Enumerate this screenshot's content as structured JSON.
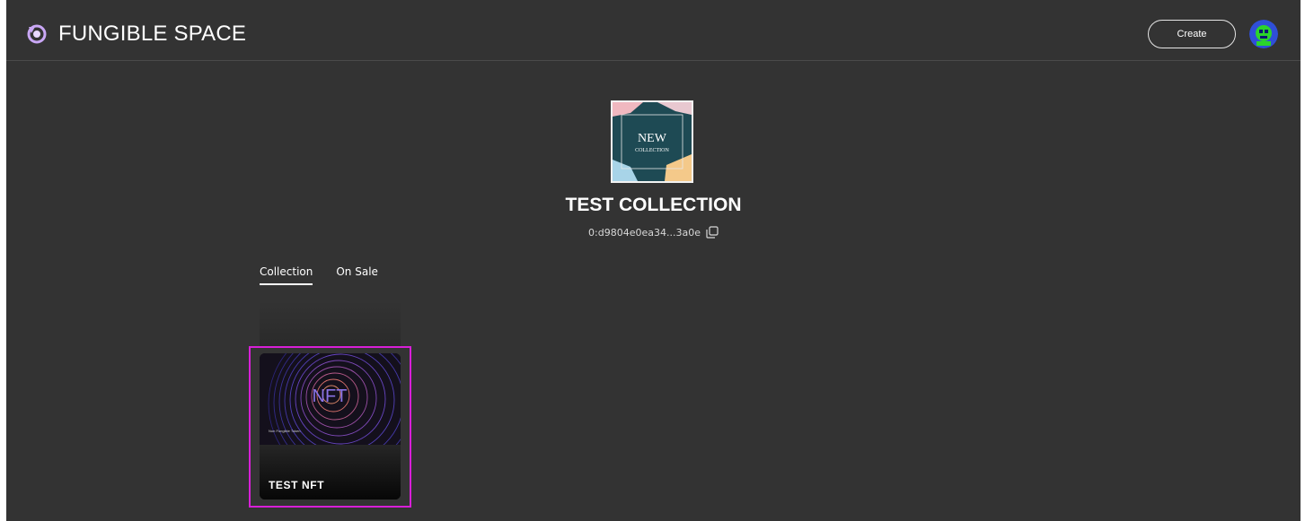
{
  "header": {
    "brand_name": "FUNGIBLE SPACE",
    "create_label": "Create"
  },
  "collection": {
    "thumbnail_title": "NEW",
    "thumbnail_subtitle": "COLLECTION",
    "title": "TEST COLLECTION",
    "address": "0:d9804e0ea34...3a0e"
  },
  "tabs": [
    {
      "label": "Collection",
      "active": true
    },
    {
      "label": "On Sale",
      "active": false
    }
  ],
  "items": [
    {
      "name": "TEST NFT",
      "image_text": "NFT",
      "image_caption": "Non Fungible Token"
    }
  ],
  "colors": {
    "background": "#333333",
    "highlight": "#d81fd8",
    "brand_logo": "#c9a7f5"
  }
}
